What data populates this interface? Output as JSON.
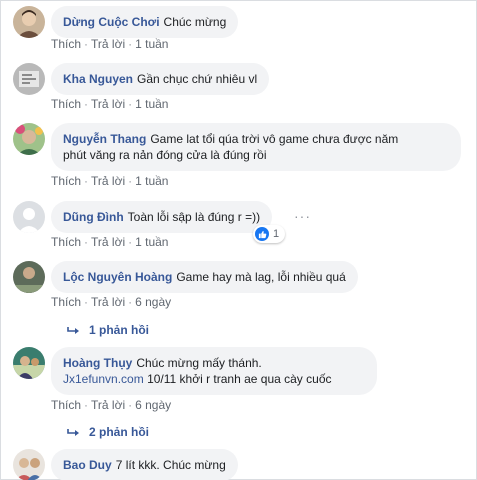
{
  "comments": [
    {
      "name": "Dừng Cuộc Chơi",
      "text": "Chúc mừng",
      "like": "Thích",
      "reply": "Trả lời",
      "time": "1 tuần"
    },
    {
      "name": "Kha Nguyen",
      "text": "Gần chục chứ nhiêu vl",
      "like": "Thích",
      "reply": "Trả lời",
      "time": "1 tuần"
    },
    {
      "name": "Nguyễn Thang",
      "text_line1": "Game lat tổi qúa trời vô game chưa được năm",
      "text_line2": "phút văng ra nản đóng cửa là đúng rồi",
      "like": "Thích",
      "reply": "Trả lời",
      "time": "1 tuần"
    },
    {
      "name": "Dũng Đình",
      "text": "Toàn lỗi sập là đúng r =))",
      "like": "Thích",
      "reply": "Trả lời",
      "time": "1 tuần",
      "more": "···",
      "reaction_count": "1"
    },
    {
      "name": "Lộc Nguyên Hoàng",
      "text": "Game hay mà lag, lỗi nhiều quá",
      "like": "Thích",
      "reply": "Trả lời",
      "time": "6 ngày",
      "replies": "1 phản hồi"
    },
    {
      "name": "Hoàng Thụy",
      "text_line1": "Chúc mừng mấy thánh.",
      "link": "Jx1efunvn.com",
      "text_line2": "10/11 khởi r tranh ae qua cày cuốc",
      "like": "Thích",
      "reply": "Trả lời",
      "time": "6 ngày",
      "replies": "2 phản hồi"
    },
    {
      "name": "Bao Duy",
      "text": "7 lít kkk. Chúc mừng"
    }
  ],
  "separator": "·",
  "colors": {
    "name": "#385898",
    "bubble": "#f2f3f5",
    "meta": "#606770",
    "like_blue": "#1877f2"
  }
}
